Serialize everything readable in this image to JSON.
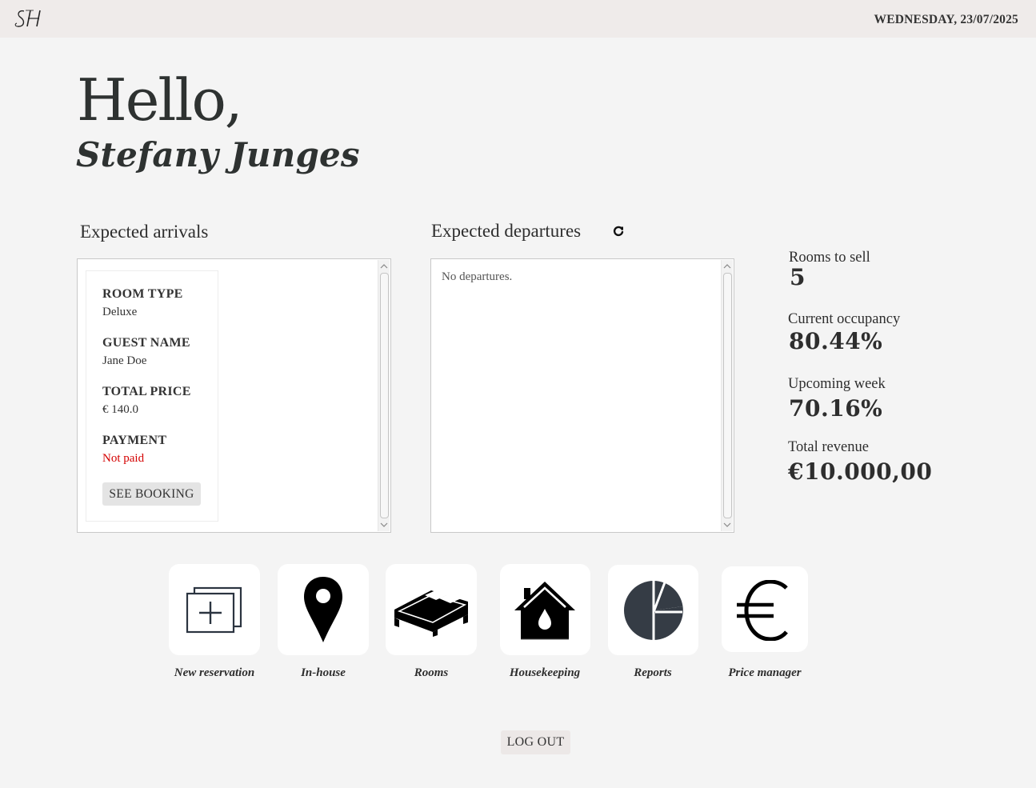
{
  "header": {
    "logo_text": "SH",
    "date": "WEDNESDAY, 23/07/2025"
  },
  "greeting": {
    "hello": "Hello,",
    "name": "Stefany Junges"
  },
  "arrivals": {
    "title": "Expected arrivals",
    "bookings": [
      {
        "room_type_label": "ROOM TYPE",
        "room_type": "Deluxe",
        "guest_name_label": "GUEST NAME",
        "guest_name": "Jane Doe",
        "total_price_label": "TOTAL PRICE",
        "total_price": "€ 140.0",
        "payment_label": "PAYMENT",
        "payment": "Not paid",
        "button_label": "SEE BOOKING"
      }
    ]
  },
  "departures": {
    "title": "Expected departures",
    "empty_text": "No departures.",
    "refresh_icon": "refresh-icon"
  },
  "stats": {
    "rooms_to_sell_label": "Rooms to sell",
    "rooms_to_sell": "5",
    "current_occupancy_label": "Current occupancy",
    "current_occupancy": "80.44%",
    "upcoming_week_label": "Upcoming week",
    "upcoming_week": "70.16%",
    "total_revenue_label": "Total revenue",
    "total_revenue": "€10.000,00"
  },
  "tiles": [
    {
      "label": "New reservation",
      "icon": "new-reservation-icon"
    },
    {
      "label": "In-house",
      "icon": "map-pin-icon"
    },
    {
      "label": "Rooms",
      "icon": "bed-icon"
    },
    {
      "label": "Housekeeping",
      "icon": "house-drop-icon"
    },
    {
      "label": "Reports",
      "icon": "pie-chart-icon"
    },
    {
      "label": "Price manager",
      "icon": "euro-icon"
    }
  ],
  "logout_label": "LOG OUT",
  "colors": {
    "background": "#f4f4f4",
    "topbar": "#efebea",
    "text": "#2e2e2e",
    "not_paid": "#d40000",
    "button": "#e4e4e4"
  }
}
